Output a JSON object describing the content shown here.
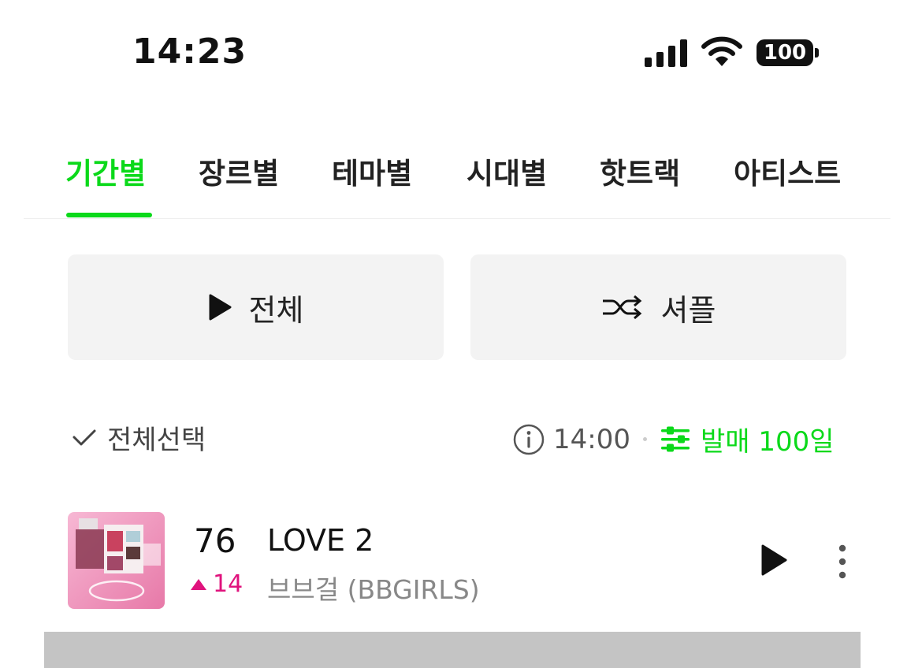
{
  "status_bar": {
    "time": "14:23",
    "battery": "100",
    "signal_icon": "signal-bars-icon",
    "wifi_icon": "wifi-icon"
  },
  "tabs": [
    {
      "label": "기간별",
      "active": true
    },
    {
      "label": "장르별",
      "active": false
    },
    {
      "label": "테마별",
      "active": false
    },
    {
      "label": "시대별",
      "active": false
    },
    {
      "label": "핫트랙",
      "active": false
    },
    {
      "label": "아티스트",
      "active": false
    }
  ],
  "actions": {
    "play_all_label": "전체",
    "shuffle_label": "셔플"
  },
  "list_header": {
    "select_all_label": "전체선택",
    "update_time": "14:00",
    "filter_label": "발매 100일"
  },
  "songs": [
    {
      "rank": "76",
      "change": "14",
      "change_direction": "up",
      "title": "LOVE 2",
      "artist": "브브걸 (BBGIRLS)"
    }
  ],
  "colors": {
    "accent": "#0bd91a",
    "rank_up": "#e0137d"
  }
}
